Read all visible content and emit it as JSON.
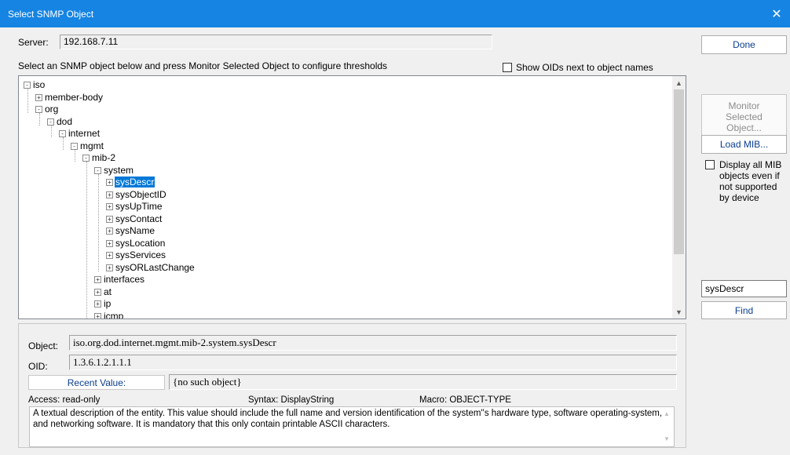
{
  "window": {
    "title": "Select SNMP Object",
    "close_glyph": "✕"
  },
  "server": {
    "label": "Server:",
    "value": "192.168.7.11"
  },
  "instructions": "Select an SNMP object below and press Monitor Selected Object to configure thresholds",
  "show_oids": {
    "label": "Show OIDs next to object names",
    "checked": false
  },
  "tree": [
    {
      "label": "iso",
      "toggle": "-",
      "level": 0
    },
    {
      "label": "member-body",
      "toggle": "+",
      "level": 1
    },
    {
      "label": "org",
      "toggle": "-",
      "level": 1
    },
    {
      "label": "dod",
      "toggle": "-",
      "level": 2
    },
    {
      "label": "internet",
      "toggle": "-",
      "level": 3
    },
    {
      "label": "mgmt",
      "toggle": "-",
      "level": 4
    },
    {
      "label": "mib-2",
      "toggle": "-",
      "level": 5
    },
    {
      "label": "system",
      "toggle": "-",
      "level": 6
    },
    {
      "label": "sysDescr",
      "toggle": "+",
      "level": 7,
      "selected": true
    },
    {
      "label": "sysObjectID",
      "toggle": "+",
      "level": 7
    },
    {
      "label": "sysUpTime",
      "toggle": "+",
      "level": 7
    },
    {
      "label": "sysContact",
      "toggle": "+",
      "level": 7
    },
    {
      "label": "sysName",
      "toggle": "+",
      "level": 7
    },
    {
      "label": "sysLocation",
      "toggle": "+",
      "level": 7
    },
    {
      "label": "sysServices",
      "toggle": "+",
      "level": 7
    },
    {
      "label": "sysORLastChange",
      "toggle": "+",
      "level": 7
    },
    {
      "label": "interfaces",
      "toggle": "+",
      "level": 6
    },
    {
      "label": "at",
      "toggle": "+",
      "level": 6
    },
    {
      "label": "ip",
      "toggle": "+",
      "level": 6
    },
    {
      "label": "icmp",
      "toggle": "+",
      "level": 6
    }
  ],
  "buttons": {
    "done": "Done",
    "monitor": [
      "Monitor",
      "Selected",
      "Object..."
    ],
    "load_mib": "Load MIB...",
    "find": "Find"
  },
  "display_all": {
    "label": "Display all MIB objects even if not supported by device",
    "checked": false
  },
  "find_input": {
    "value": "sysDescr"
  },
  "details": {
    "object_label": "Object:",
    "object_value": "iso.org.dod.internet.mgmt.mib-2.system.sysDescr",
    "oid_label": "OID:",
    "oid_value": "1.3.6.1.2.1.1.1",
    "recent_button": "Recent Value:",
    "recent_value": "{no such object}",
    "access": "Access:   read-only",
    "syntax": "Syntax:  DisplayString",
    "macro": "Macro:  OBJECT-TYPE",
    "description": "A textual description of the entity.  This value  should include the full name and version  identification of the system''s hardware type,  software operating-system, and networking  software.  It is mandatory that this only contain  printable ASCII characters."
  },
  "colors": {
    "titlebar": "#1584e2",
    "selection": "#0078d7",
    "button_text": "#0a3d91"
  }
}
